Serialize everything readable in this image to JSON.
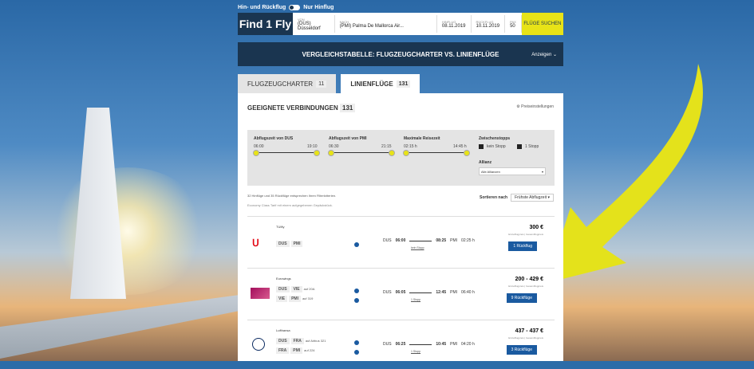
{
  "top": {
    "roundtrip": "Hin- und Rückflug",
    "oneway": "Nur Hinflug"
  },
  "search": {
    "logo": "Find 1 Fly",
    "from_lbl": "VON",
    "from": "(DUS) Düsseldorf",
    "to_lbl": "NACH",
    "to": "(PMI) Palma De Mallorca Air...",
    "dep_lbl": "HINFLUG",
    "dep": "08.11.2019",
    "ret_lbl": "RÜCKFLUG",
    "ret": "10.11.2019",
    "pax_lbl": "PAX",
    "pax": "50",
    "btn": "FLÜGE SUCHEN"
  },
  "compare": {
    "title": "VERGLEICHSTABELLE: FLUGZEUGCHARTER VS. LINIENFLÜGE",
    "show": "Anzeigen"
  },
  "tabs": [
    {
      "label": "FLUGZEUGCHARTER",
      "count": "11"
    },
    {
      "label": "LINIENFLÜGE",
      "count": "131"
    }
  ],
  "panel": {
    "title": "GEEIGNETE VERBINDUNGEN",
    "count": "131",
    "settings": "Preiseinstellungen"
  },
  "filters": {
    "dus": "Abflugszeit von DUS",
    "dus_a": "06:00",
    "dus_b": "19:10",
    "pmi": "Abflugszeit von PMI",
    "pmi_a": "06:30",
    "pmi_b": "21:15",
    "dur": "Maximale Reisezeit",
    "dur_a": "02:15 h",
    "dur_b": "14:45 h",
    "stops": "Zwischenstopps",
    "s0": "kein Stopp",
    "s1": "1 Stopp",
    "allianz": "Allianz",
    "allianz_val": "Alle Allianzen"
  },
  "info": {
    "line1": "32 Hinflüge und 35 Rückflüge entsprechen Ihren Filterkriterien.",
    "line2": "Economy Class Tarif mit einem aufgegebenen Gepäckstück.",
    "sort_lbl": "Sortieren nach",
    "sort_val": "Frühste Abflugzeit"
  },
  "rows": [
    {
      "airline": "TUIfly",
      "a": "DUS",
      "b": "PMI",
      "dep_ap": "DUS",
      "dep": "06:00",
      "arr": "08:25",
      "arr_ap": "PMI",
      "dur": "02:25 h",
      "stop": "kein Stopp",
      "price": "300 €",
      "btn": "1 Rückflug"
    },
    {
      "airline": "Eurowings",
      "a": "DUS",
      "b": "VIE",
      "c": "VIE",
      "d": "PMI",
      "l1": "auf 20A",
      "l2": "auf 319",
      "dep_ap": "DUS",
      "dep": "06:05",
      "arr": "12:45",
      "arr_ap": "PMI",
      "dur": "06:40 h",
      "stop": "1 Stopp",
      "price": "200 - 429 €",
      "btn": "9 Rückflüge"
    },
    {
      "airline": "Lufthansa",
      "a": "DUS",
      "b": "FRA",
      "c": "FRA",
      "d": "PMI",
      "l1": "auf Airbus 321",
      "l2": "auf 224",
      "dep_ap": "DUS",
      "dep": "06:25",
      "arr": "10:45",
      "arr_ap": "PMI",
      "dur": "04:20 h",
      "stop": "1 Stopp",
      "price": "437 - 437 €",
      "btn": "3 Rückflüge"
    }
  ],
  "price_links": "Einzelflugpreis | Gesamtflugpreis"
}
